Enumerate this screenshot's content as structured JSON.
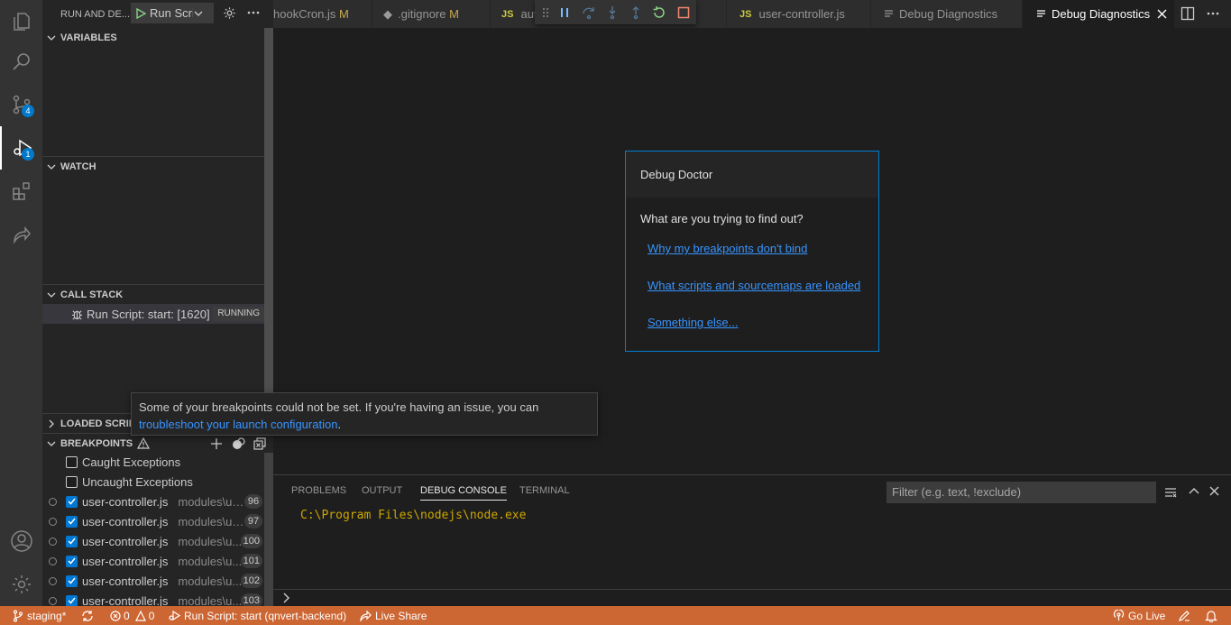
{
  "activity": {
    "scm_badge": "4",
    "debug_badge": "1"
  },
  "sidebar": {
    "title": "RUN AND DE...",
    "config_label": "Run Script",
    "variables_header": "VARIABLES",
    "watch_header": "WATCH",
    "callstack_header": "CALL STACK",
    "callstack_item": "Run Script: start: [1620]",
    "callstack_status": "RUNNING",
    "loaded_scripts_header": "LOADED SCRIPTS",
    "breakpoints_header": "BREAKPOINTS",
    "exceptions": [
      {
        "label": "Caught Exceptions",
        "checked": false
      },
      {
        "label": "Uncaught Exceptions",
        "checked": false
      }
    ],
    "breakpoints": [
      {
        "file": "user-controller.js",
        "path": "modules\\us...",
        "line": "96"
      },
      {
        "file": "user-controller.js",
        "path": "modules\\us...",
        "line": "97"
      },
      {
        "file": "user-controller.js",
        "path": "modules\\u...",
        "line": "100"
      },
      {
        "file": "user-controller.js",
        "path": "modules\\u...",
        "line": "101"
      },
      {
        "file": "user-controller.js",
        "path": "modules\\u...",
        "line": "102"
      },
      {
        "file": "user-controller.js",
        "path": "modules\\u...",
        "line": "103"
      }
    ]
  },
  "tabs": [
    {
      "label": "hookCron.js",
      "modified": "M"
    },
    {
      "label": ".gitignore",
      "modified": "M"
    },
    {
      "label": "aut",
      "prefix": "JS"
    },
    {
      "label": "user-controller.js",
      "prefix": "JS"
    },
    {
      "label": "Debug Diagnostics"
    },
    {
      "label": "Debug Diagnostics",
      "active": true
    }
  ],
  "doctor": {
    "title": "Debug Doctor",
    "question": "What are you trying to find out?",
    "links": [
      "Why my breakpoints don't bind",
      "What scripts and sourcemaps are loaded",
      "Something else..."
    ]
  },
  "tooltip": {
    "text": "Some of your breakpoints could not be set. If you're having an issue, you can",
    "link": "troubleshoot your launch configuration",
    "suffix": "."
  },
  "panel": {
    "tabs": [
      "PROBLEMS",
      "OUTPUT",
      "DEBUG CONSOLE",
      "TERMINAL"
    ],
    "active_tab": "DEBUG CONSOLE",
    "filter_placeholder": "Filter (e.g. text, !exclude)",
    "console_output": "C:\\Program Files\\nodejs\\node.exe"
  },
  "status": {
    "branch": "staging*",
    "errors": "0",
    "warnings": "0",
    "launch": "Run Script: start (qnvert-backend)",
    "live_share": "Live Share",
    "go_live": "Go Live"
  },
  "colors": {
    "status_bar": "#cc6633",
    "accent": "#007acc",
    "link": "#3794ff",
    "console_text": "#cca700"
  }
}
